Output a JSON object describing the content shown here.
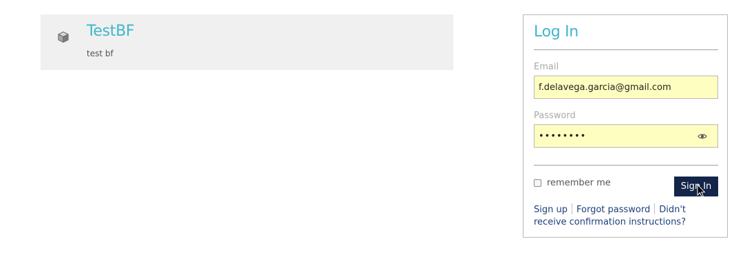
{
  "project": {
    "icon": "cube-icon",
    "title": "TestBF",
    "description": "test bf"
  },
  "login": {
    "title": "Log In",
    "email_label": "Email",
    "email_value": "f.delavega.garcia@gmail.com",
    "password_label": "Password",
    "password_value": "••••••••",
    "password_toggle_icon": "eye-icon",
    "remember_label": "remember me",
    "remember_checked": false,
    "signin_label": "Sign In",
    "links": {
      "signup": "Sign up",
      "forgot": "Forgot password",
      "confirm": "Didn't receive confirmation instructions?"
    }
  },
  "colors": {
    "accent": "#3fb6cc",
    "button": "#14254a",
    "autofill": "#fefec0",
    "link": "#1c3f7a"
  }
}
